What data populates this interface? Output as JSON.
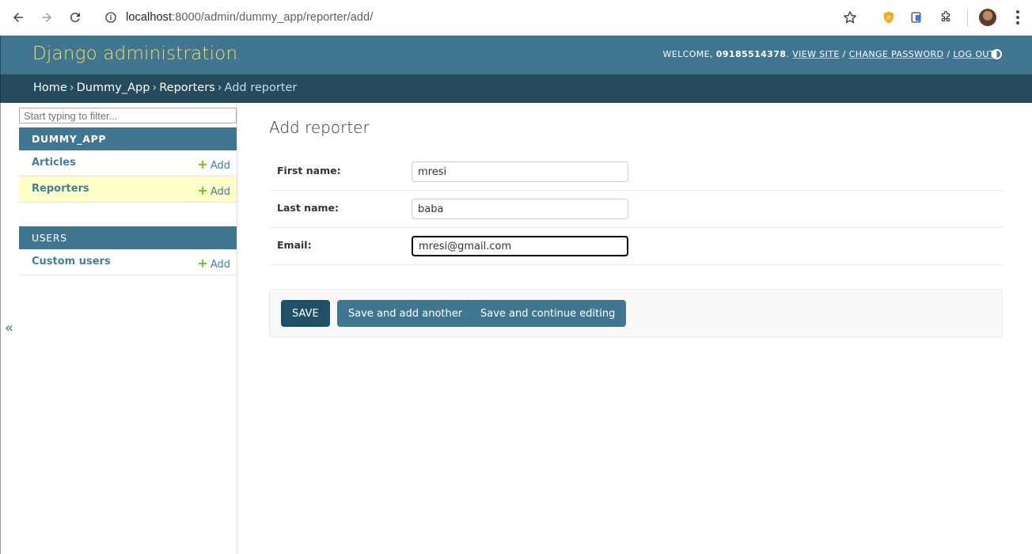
{
  "browser": {
    "url_host": "localhost",
    "url_path": ":8000/admin/dummy_app/reporter/add/"
  },
  "header": {
    "branding": "Django administration",
    "welcome_prefix": "Welcome,",
    "username": "09185514378",
    "view_site": "View site",
    "change_password": "Change password",
    "log_out": "Log out"
  },
  "breadcrumbs": {
    "home": "Home",
    "app": "Dummy_App",
    "model": "Reporters",
    "current": "Add reporter"
  },
  "sidebar": {
    "filter_placeholder": "Start typing to filter...",
    "toggle": "«",
    "modules": [
      {
        "caption": "DUMMY_APP",
        "models": [
          {
            "name": "Articles",
            "add": "Add"
          },
          {
            "name": "Reporters",
            "add": "Add"
          }
        ]
      },
      {
        "caption": "USERS",
        "models": [
          {
            "name": "Custom users",
            "add": "Add"
          }
        ]
      }
    ]
  },
  "main": {
    "title": "Add reporter",
    "fields": [
      {
        "label": "First name:",
        "value": "mresi"
      },
      {
        "label": "Last name:",
        "value": "baba"
      },
      {
        "label": "Email:",
        "value": "mresi@gmail.com"
      }
    ],
    "buttons": {
      "save": "SAVE",
      "save_add_another": "Save and add another",
      "save_continue": "Save and continue editing"
    }
  }
}
